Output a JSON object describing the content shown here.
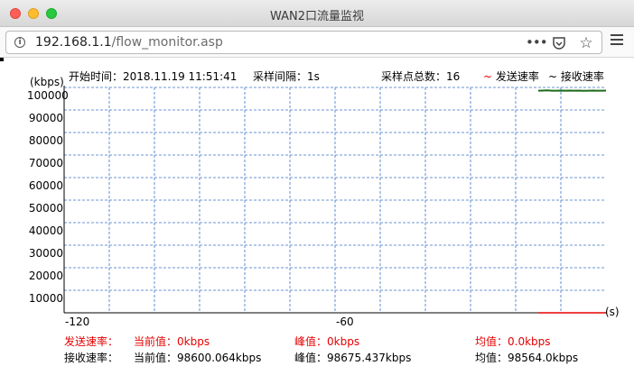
{
  "window": {
    "title": "WAN2口流量监视"
  },
  "browser": {
    "url_host": "192.168.1.1",
    "url_path": "/flow_monitor.asp",
    "more_label": "•••",
    "star_label": "☆"
  },
  "monitor": {
    "start_label": "开始时间：",
    "start_value": "2018.11.19 11:51:41",
    "interval_label": "采样间隔：",
    "interval_value": "1s",
    "points_label": "采样点总数：",
    "points_value": "16",
    "legend_send_symbol": "~",
    "legend_send": "发送速率",
    "legend_recv_symbol": "~",
    "legend_recv": "接收速率",
    "send_color": "#e60000",
    "recv_color": "#1a6b1a"
  },
  "chart_data": {
    "type": "line",
    "ylabel": "(kbps)",
    "xlabel": "(s)",
    "y_ticks": [
      "100000",
      "90000",
      "80000",
      "70000",
      "60000",
      "50000",
      "40000",
      "30000",
      "20000",
      "10000"
    ],
    "x_ticks": [
      "-120",
      "-60"
    ],
    "ylim": [
      0,
      100000
    ],
    "xlim": [
      -120,
      0
    ],
    "grid": true,
    "series": [
      {
        "name": "发送速率",
        "x": [
          -15,
          -14,
          -13,
          -12,
          -11,
          -10,
          -9,
          -8,
          -7,
          -6,
          -5,
          -4,
          -3,
          -2,
          -1,
          0
        ],
        "values": [
          0,
          0,
          0,
          0,
          0,
          0,
          0,
          0,
          0,
          0,
          0,
          0,
          0,
          0,
          0,
          0
        ]
      },
      {
        "name": "接收速率",
        "x": [
          -15,
          -14,
          -13,
          -12,
          -11,
          -10,
          -9,
          -8,
          -7,
          -6,
          -5,
          -4,
          -3,
          -2,
          -1,
          0
        ],
        "values": [
          98550,
          98600,
          98675,
          98560,
          98580,
          98620,
          98540,
          98600,
          98560,
          98590,
          98530,
          98580,
          98610,
          98540,
          98570,
          98600
        ]
      }
    ]
  },
  "stats": {
    "send": {
      "label": "发送速率：",
      "current_label": "当前值：",
      "current_value": "0kbps",
      "peak_label": "峰值：",
      "peak_value": "0kbps",
      "avg_label": "均值：",
      "avg_value": "0.0kbps"
    },
    "recv": {
      "label": "接收速率：",
      "current_label": "当前值：",
      "current_value": "98600.064kbps",
      "peak_label": "峰值：",
      "peak_value": "98675.437kbps",
      "avg_label": "均值：",
      "avg_value": "98564.0kbps"
    }
  }
}
